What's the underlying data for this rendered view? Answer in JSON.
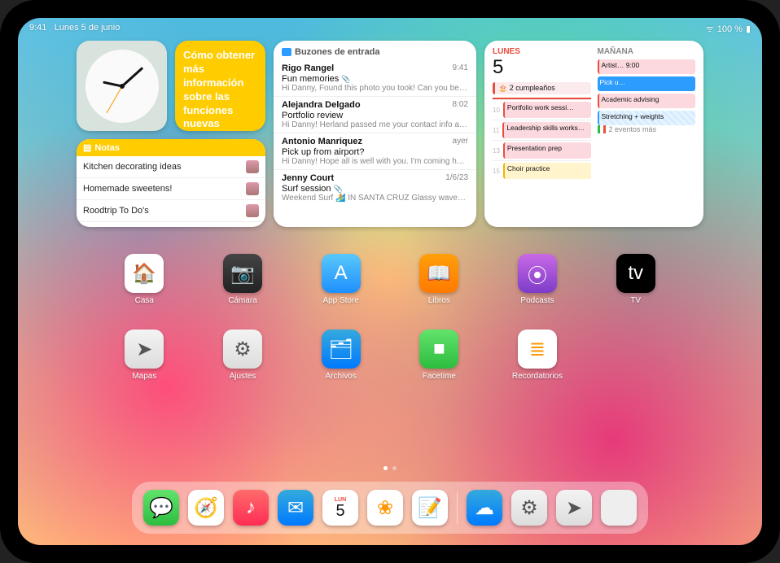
{
  "status": {
    "time": "9:41",
    "date": "Lunes 5 de junio",
    "battery": "100 %"
  },
  "widgets": {
    "tip": "Cómo obtener más información sobre las funciones nuevas",
    "notes": {
      "title": "Notas",
      "items": [
        {
          "title": "Kitchen decorating ideas"
        },
        {
          "title": "Homemade sweetens!"
        },
        {
          "title": "Roodtrip To Do's"
        }
      ]
    },
    "mail": {
      "title": "Buzones de entrada",
      "items": [
        {
          "from": "Rigo Rangel",
          "time": "9:41",
          "subject": "Fun memories",
          "preview": "Hi Danny, Found this photo you took! Can you bel…",
          "attach": true
        },
        {
          "from": "Alejandra Delgado",
          "time": "8:02",
          "subject": "Portfolio review",
          "preview": "Hi Danny! Herland passed me your contact info a…",
          "attach": false
        },
        {
          "from": "Antonio Manriquez",
          "time": "ayer",
          "subject": "Pick up from airport?",
          "preview": "Hi Danny! Hope all is well with you. I'm coming ho…",
          "attach": false
        },
        {
          "from": "Jenny Court",
          "time": "1/6/23",
          "subject": "Surf session",
          "preview": "Weekend Surf 🏄 IN SANTA CRUZ Glassy waves…",
          "attach": true
        }
      ]
    },
    "calendar": {
      "today_label": "LUNES",
      "today_num": "5",
      "tomorrow_label": "MAÑANA",
      "allday_today": "2 cumpleaños",
      "more": "2 eventos más",
      "today_events": [
        {
          "h": "10",
          "t": "Portfolio work sessi…",
          "c": "pink"
        },
        {
          "h": "11",
          "t": "Leadership skills workshop",
          "c": "pink"
        },
        {
          "h": "13",
          "t": "Presentation prep",
          "c": "pink"
        },
        {
          "h": "15",
          "t": "Choir practice",
          "c": "yellow"
        }
      ],
      "tomorrow_events": [
        {
          "t": "Artist… 9:00",
          "c": "pink"
        },
        {
          "t": "Pick u…",
          "c": "solidblue"
        },
        {
          "t": "Academic advising",
          "c": "pink"
        },
        {
          "t": "Stretching + weights",
          "c": "stripe"
        }
      ]
    }
  },
  "apps_row1": [
    {
      "label": "Casa",
      "icon": "🏠",
      "cls": "bg-white"
    },
    {
      "label": "Cámara",
      "icon": "📷",
      "cls": "bg-grey"
    },
    {
      "label": "App Store",
      "icon": "A",
      "cls": "bg-blue"
    },
    {
      "label": "Libros",
      "icon": "📖",
      "cls": "bg-orange"
    },
    {
      "label": "Podcasts",
      "icon": "⦿",
      "cls": "bg-purple"
    },
    {
      "label": "TV",
      "icon": "tv",
      "cls": "bg-black"
    }
  ],
  "apps_row2": [
    {
      "label": "Mapas",
      "icon": "➤",
      "cls": "bg-grad"
    },
    {
      "label": "Ajustes",
      "icon": "⚙",
      "cls": "bg-grad"
    },
    {
      "label": "Archivos",
      "icon": "🗂",
      "cls": "bg-sky"
    },
    {
      "label": "Facetime",
      "icon": "■",
      "cls": "bg-green"
    },
    {
      "label": "Recordatorios",
      "icon": "≣",
      "cls": "bg-white"
    }
  ],
  "dock": [
    {
      "name": "messages",
      "icon": "💬",
      "cls": "bg-green"
    },
    {
      "name": "safari",
      "icon": "🧭",
      "cls": "bg-white"
    },
    {
      "name": "music",
      "icon": "♪",
      "cls": "bg-red"
    },
    {
      "name": "mail",
      "icon": "✉",
      "cls": "bg-sky"
    },
    {
      "name": "calendar",
      "icon": "cal",
      "cls": "bg-cal"
    },
    {
      "name": "photos",
      "icon": "❀",
      "cls": "bg-white"
    },
    {
      "name": "notes",
      "icon": "📝",
      "cls": "bg-white"
    }
  ],
  "dock_recent": [
    {
      "name": "weather",
      "icon": "☁",
      "cls": "bg-sky"
    },
    {
      "name": "settings",
      "icon": "⚙",
      "cls": "bg-grad"
    },
    {
      "name": "maps",
      "icon": "➤",
      "cls": "bg-grad"
    },
    {
      "name": "applib",
      "icon": "lib",
      "cls": "bg-applib"
    }
  ],
  "cal_day_short": "LUN"
}
